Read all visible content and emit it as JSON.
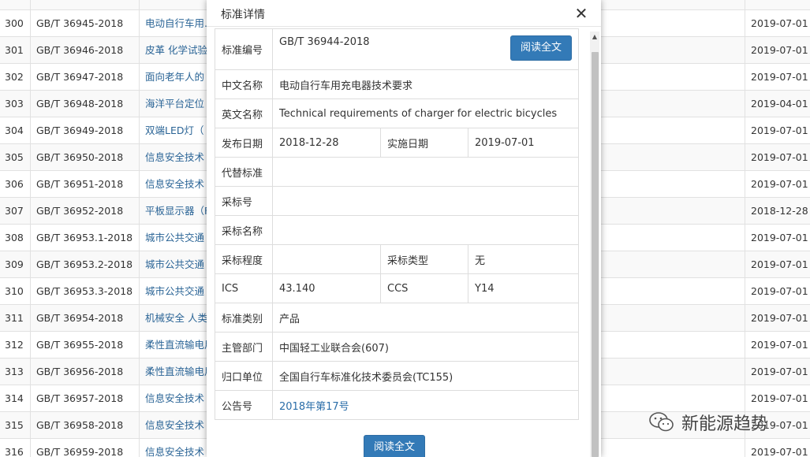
{
  "background_table": {
    "rows": [
      {
        "num": "300",
        "code": "GB/T 36945-2018",
        "title": "电动自行车用...",
        "date": "2019-07-01"
      },
      {
        "num": "301",
        "code": "GB/T 36946-2018",
        "title": "皮革 化学试验",
        "date": "2019-07-01"
      },
      {
        "num": "302",
        "code": "GB/T 36947-2018",
        "title": "面向老年人的",
        "date": "2019-07-01"
      },
      {
        "num": "303",
        "code": "GB/T 36948-2018",
        "title": "海洋平台定位",
        "date": "2019-04-01"
      },
      {
        "num": "304",
        "code": "GB/T 36949-2018",
        "title": "双端LED灯（",
        "date": "2019-07-01"
      },
      {
        "num": "305",
        "code": "GB/T 36950-2018",
        "title": "信息安全技术",
        "date": "2019-07-01"
      },
      {
        "num": "306",
        "code": "GB/T 36951-2018",
        "title": "信息安全技术",
        "date": "2019-07-01"
      },
      {
        "num": "307",
        "code": "GB/T 36952-2018",
        "title": "平板显示器（F",
        "date": "2018-12-28"
      },
      {
        "num": "308",
        "code": "GB/T 36953.1-2018",
        "title": "城市公共交通",
        "date": "2019-07-01"
      },
      {
        "num": "309",
        "code": "GB/T 36953.2-2018",
        "title": "城市公共交通",
        "date": "2019-07-01"
      },
      {
        "num": "310",
        "code": "GB/T 36953.3-2018",
        "title": "城市公共交通",
        "date": "2019-07-01"
      },
      {
        "num": "311",
        "code": "GB/T 36954-2018",
        "title": "机械安全 人类",
        "date": "2019-07-01"
      },
      {
        "num": "312",
        "code": "GB/T 36955-2018",
        "title": "柔性直流输电用",
        "date": "2019-07-01"
      },
      {
        "num": "313",
        "code": "GB/T 36956-2018",
        "title": "柔性直流输电用",
        "date": "2019-07-01"
      },
      {
        "num": "314",
        "code": "GB/T 36957-2018",
        "title": "信息安全技术",
        "date": "2019-07-01"
      },
      {
        "num": "315",
        "code": "GB/T 36958-2018",
        "title": "信息安全技术",
        "date": "2019-07-01"
      },
      {
        "num": "316",
        "code": "GB/T 36959-2018",
        "title": "信息安全技术",
        "date": "2019-07-01"
      }
    ]
  },
  "modal": {
    "title": "标准详情",
    "close_icon": "close-icon",
    "read_full_label": "阅读全文",
    "fields": {
      "std_no_label": "标准编号",
      "std_no": "GB/T 36944-2018",
      "cn_name_label": "中文名称",
      "cn_name": "电动自行车用充电器技术要求",
      "en_name_label": "英文名称",
      "en_name": "Technical requirements of charger for electric bicycles",
      "publish_label": "发布日期",
      "publish": "2018-12-28",
      "implement_label": "实施日期",
      "implement": "2019-07-01",
      "replace_label": "代替标准",
      "replace": "",
      "adopt_no_label": "采标号",
      "adopt_no": "",
      "adopt_name_label": "采标名称",
      "adopt_name": "",
      "adopt_degree_label": "采标程度",
      "adopt_degree": "",
      "adopt_type_label": "采标类型",
      "adopt_type": "无",
      "ics_label": "ICS",
      "ics": "43.140",
      "ccs_label": "CCS",
      "ccs": "Y14",
      "category_label": "标准类别",
      "category": "产品",
      "dept_label": "主管部门",
      "dept": "中国轻工业联合会(607)",
      "unit_label": "归口单位",
      "unit": "全国自行车标准化技术委员会(TC155)",
      "notice_label": "公告号",
      "notice": "2018年第17号"
    }
  },
  "watermark": {
    "text": "新能源趋势",
    "icon": "wechat-icon"
  }
}
